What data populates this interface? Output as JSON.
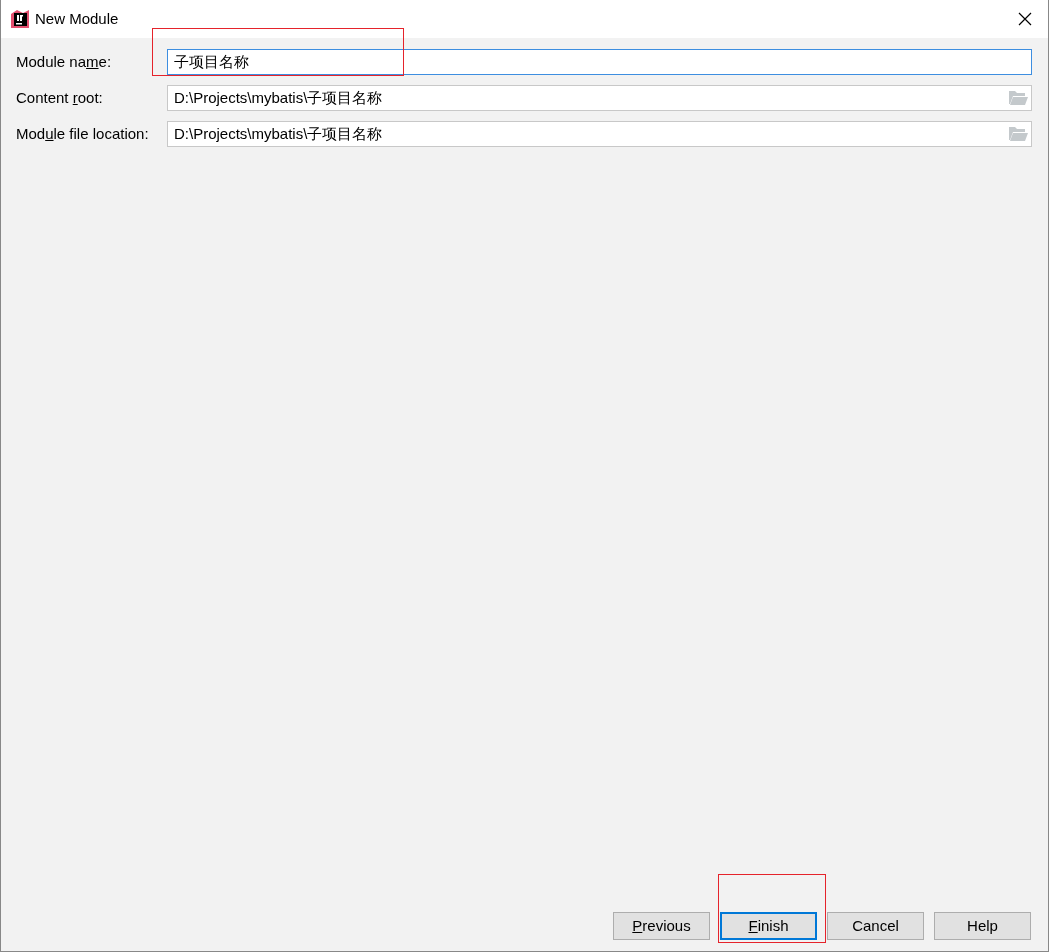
{
  "window": {
    "title": "New Module"
  },
  "fields": [
    {
      "label": [
        {
          "text": "Module na",
          "underlined": false
        },
        {
          "text": "m",
          "underlined": true
        },
        {
          "text": "e:",
          "underlined": false
        }
      ],
      "value": "子项目名称",
      "focused": true,
      "browse": false,
      "highlighted": true
    },
    {
      "label": [
        {
          "text": "Content ",
          "underlined": false
        },
        {
          "text": "r",
          "underlined": true
        },
        {
          "text": "oot:",
          "underlined": false
        }
      ],
      "value": "D:\\Projects\\mybatis\\子项目名称",
      "focused": false,
      "browse": true,
      "highlighted": false
    },
    {
      "label": [
        {
          "text": "Mod",
          "underlined": false
        },
        {
          "text": "u",
          "underlined": true
        },
        {
          "text": "le file location:",
          "underlined": false
        }
      ],
      "value": "D:\\Projects\\mybatis\\子项目名称",
      "focused": false,
      "browse": true,
      "highlighted": false
    }
  ],
  "buttons": [
    {
      "label": [
        {
          "text": "P",
          "underlined": true
        },
        {
          "text": "revious",
          "underlined": false
        }
      ],
      "default": false,
      "highlighted": false
    },
    {
      "label": [
        {
          "text": "F",
          "underlined": true
        },
        {
          "text": "inish",
          "underlined": false
        }
      ],
      "default": true,
      "highlighted": true
    },
    {
      "label": [
        {
          "text": "Cancel",
          "underlined": false
        }
      ],
      "default": false,
      "highlighted": false
    },
    {
      "label": [
        {
          "text": "Help",
          "underlined": false
        }
      ],
      "default": false,
      "highlighted": false
    }
  ]
}
